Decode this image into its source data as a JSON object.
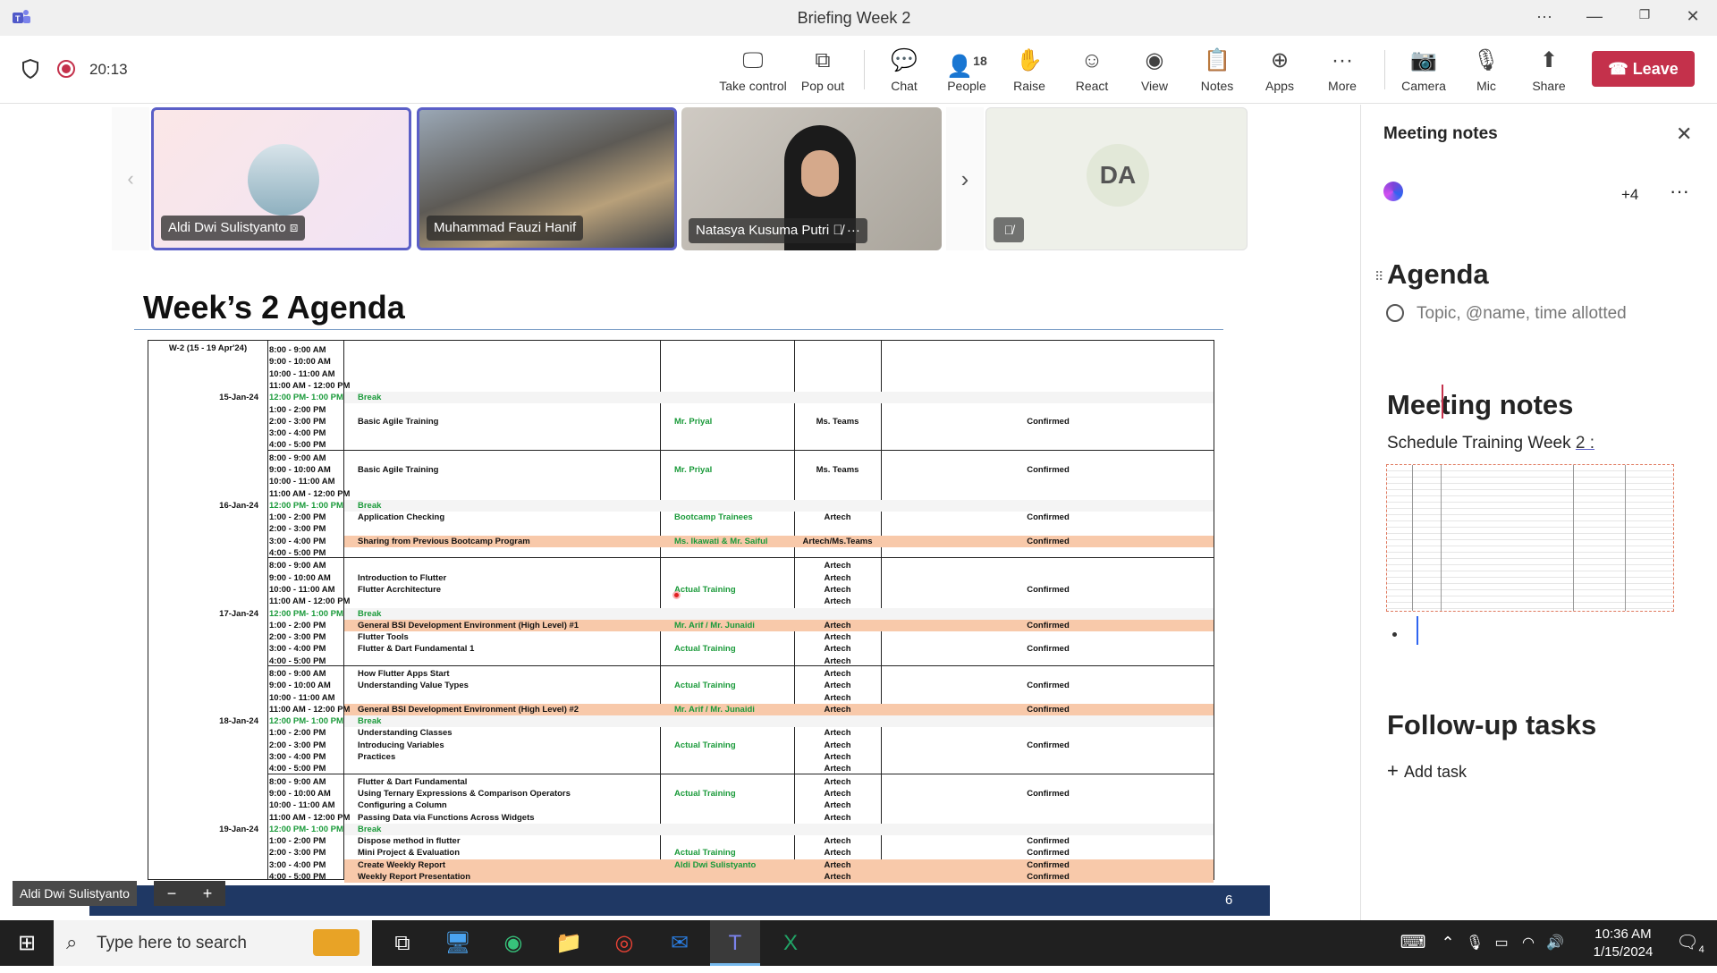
{
  "window": {
    "title": "Briefing Week 2"
  },
  "toolbar": {
    "timer": "20:13",
    "buttons": [
      {
        "label": "Take control",
        "icon": "take-control-icon"
      },
      {
        "label": "Pop out",
        "icon": "pop-out-icon"
      },
      {
        "label": "Chat",
        "icon": "chat-icon"
      },
      {
        "label": "People",
        "icon": "people-icon",
        "count": "18"
      },
      {
        "label": "Raise",
        "icon": "raise-hand-icon"
      },
      {
        "label": "React",
        "icon": "react-icon"
      },
      {
        "label": "View",
        "icon": "view-icon"
      },
      {
        "label": "Notes",
        "icon": "notes-icon"
      },
      {
        "label": "Apps",
        "icon": "apps-icon"
      },
      {
        "label": "More",
        "icon": "more-icon"
      },
      {
        "label": "Camera",
        "icon": "camera-off-icon"
      },
      {
        "label": "Mic",
        "icon": "mic-off-icon"
      },
      {
        "label": "Share",
        "icon": "share-icon"
      }
    ],
    "leave_label": "Leave"
  },
  "participants": [
    {
      "name": "Aldi Dwi Sulistyanto"
    },
    {
      "name": "Muhammad Fauzi Hanif"
    },
    {
      "name": "Natasya Kusuma Putri"
    },
    {
      "initials": "DA"
    }
  ],
  "presenter_label": "Aldi Dwi Sulistyanto",
  "slide": {
    "title": "Week’s 2 Agenda",
    "week_label": "W-2 (15 - 19 Apr'24)",
    "page_number": "6",
    "days": [
      {
        "date": "15-Jan-24",
        "rows": [
          {
            "time": "8:00 - 9:00 AM"
          },
          {
            "time": "9:00 - 10:00 AM"
          },
          {
            "time": "10:00 - 11:00 AM"
          },
          {
            "time": "11:00 AM - 12:00 PM"
          },
          {
            "time": "12:00 PM- 1:00 PM",
            "break": true,
            "topic": "Break"
          },
          {
            "time": "1:00 - 2:00 PM"
          },
          {
            "time": "2:00 - 3:00 PM",
            "topic": "Basic Agile Training",
            "speaker": "Mr. Priyal",
            "venue": "Ms. Teams",
            "status": "Confirmed"
          },
          {
            "time": "3:00 - 4:00 PM"
          },
          {
            "time": "4:00 - 5:00 PM"
          }
        ]
      },
      {
        "date": "16-Jan-24",
        "rows": [
          {
            "time": "8:00 - 9:00 AM"
          },
          {
            "time": "9:00 - 10:00 AM",
            "topic": "Basic Agile Training",
            "speaker": "Mr. Priyal",
            "venue": "Ms. Teams",
            "status": "Confirmed"
          },
          {
            "time": "10:00 - 11:00 AM"
          },
          {
            "time": "11:00 AM - 12:00 PM"
          },
          {
            "time": "12:00 PM- 1:00 PM",
            "break": true,
            "topic": "Break"
          },
          {
            "time": "1:00 - 2:00 PM",
            "topic": "Application Checking",
            "speaker": "Bootcamp Trainees",
            "venue": "Artech",
            "status": "Confirmed"
          },
          {
            "time": "2:00 - 3:00 PM"
          },
          {
            "time": "3:00 - 4:00 PM",
            "topic": "Sharing from Previous Bootcamp Program",
            "speaker": "Ms. Ikawati & Mr. Saiful",
            "venue": "Artech/Ms.Teams",
            "status": "Confirmed",
            "highlight": true
          },
          {
            "time": "4:00 - 5:00 PM"
          }
        ]
      },
      {
        "date": "17-Jan-24",
        "rows": [
          {
            "time": "8:00 - 9:00 AM",
            "venue": "Artech"
          },
          {
            "time": "9:00 - 10:00 AM",
            "topic": "Introduction to Flutter",
            "venue": "Artech"
          },
          {
            "time": "10:00 - 11:00 AM",
            "topic": "Flutter Acrchitecture",
            "speaker": "Actual Training",
            "venue": "Artech",
            "status": "Confirmed"
          },
          {
            "time": "11:00 AM - 12:00 PM",
            "venue": "Artech"
          },
          {
            "time": "12:00 PM- 1:00 PM",
            "break": true,
            "topic": "Break"
          },
          {
            "time": "1:00 - 2:00 PM",
            "topic": "General BSI Development Environment (High Level) #1",
            "speaker": "Mr. Arif / Mr. Junaidi",
            "venue": "Artech",
            "status": "Confirmed",
            "highlight": true
          },
          {
            "time": "2:00 - 3:00 PM",
            "topic": "Flutter Tools",
            "venue": "Artech"
          },
          {
            "time": "3:00 - 4:00 PM",
            "topic": "Flutter & Dart Fundamental 1",
            "speaker": "Actual Training",
            "venue": "Artech",
            "status": "Confirmed"
          },
          {
            "time": "4:00 - 5:00 PM",
            "venue": "Artech"
          }
        ]
      },
      {
        "date": "18-Jan-24",
        "rows": [
          {
            "time": "8:00 - 9:00 AM",
            "topic": "How Flutter Apps Start",
            "venue": "Artech"
          },
          {
            "time": "9:00 - 10:00 AM",
            "topic": "Understanding Value Types",
            "speaker": "Actual Training",
            "venue": "Artech",
            "status": "Confirmed"
          },
          {
            "time": "10:00 - 11:00 AM",
            "venue": "Artech"
          },
          {
            "time": "11:00 AM - 12:00 PM",
            "topic": "General BSI Development Environment (High Level) #2",
            "speaker": "Mr. Arif / Mr. Junaidi",
            "venue": "Artech",
            "status": "Confirmed",
            "highlight": true
          },
          {
            "time": "12:00 PM- 1:00 PM",
            "break": true,
            "topic": "Break"
          },
          {
            "time": "1:00 - 2:00 PM",
            "topic": "Understanding Classes",
            "venue": "Artech"
          },
          {
            "time": "2:00 - 3:00 PM",
            "topic": "Introducing Variables",
            "speaker": "Actual Training",
            "venue": "Artech",
            "status": "Confirmed"
          },
          {
            "time": "3:00 - 4:00 PM",
            "topic": "Practices",
            "venue": "Artech"
          },
          {
            "time": "4:00 - 5:00 PM",
            "venue": "Artech"
          }
        ]
      },
      {
        "date": "19-Jan-24",
        "rows": [
          {
            "time": "8:00 - 9:00 AM",
            "topic": "Flutter & Dart Fundamental",
            "venue": "Artech"
          },
          {
            "time": "9:00 - 10:00 AM",
            "topic": "Using Ternary Expressions & Comparison Operators",
            "speaker": "Actual Training",
            "venue": "Artech",
            "status": "Confirmed"
          },
          {
            "time": "10:00 - 11:00 AM",
            "topic": "Configuring a Column",
            "venue": "Artech"
          },
          {
            "time": "11:00 AM - 12:00 PM",
            "topic": "Passing Data via Functions Across Widgets",
            "venue": "Artech"
          },
          {
            "time": "12:00 PM- 1:00 PM",
            "break": true,
            "topic": "Break"
          },
          {
            "time": "1:00 - 2:00 PM",
            "topic": "Dispose method in flutter",
            "venue": "Artech",
            "status": "Confirmed"
          },
          {
            "time": "2:00 - 3:00 PM",
            "topic": "Mini Project & Evaluation",
            "speaker": "Actual Training",
            "venue": "Artech",
            "status": "Confirmed"
          },
          {
            "time": "3:00 - 4:00 PM",
            "topic": "Create Weekly Report",
            "speaker": "Aldi Dwi Sulistyanto",
            "venue": "Artech",
            "status": "Confirmed",
            "highlight": true
          },
          {
            "time": "4:00 - 5:00 PM",
            "topic": "Weekly Report Presentation",
            "venue": "Artech",
            "status": "Confirmed",
            "highlight": true
          }
        ]
      }
    ]
  },
  "notes_panel": {
    "header": "Meeting notes",
    "collaborators_extra": "+4",
    "agenda_heading": "Agenda",
    "agenda_placeholder": "Topic, @name, time allotted",
    "notes_heading": "Meeting notes",
    "notes_text_prefix": "Schedule Training Week ",
    "notes_text_link": "2 :",
    "followup_heading": "Follow-up tasks",
    "add_task_label": "Add task"
  },
  "taskbar": {
    "search_placeholder": "Type here to search",
    "time": "10:36 AM",
    "date": "1/15/2024",
    "notification_count": "4"
  }
}
